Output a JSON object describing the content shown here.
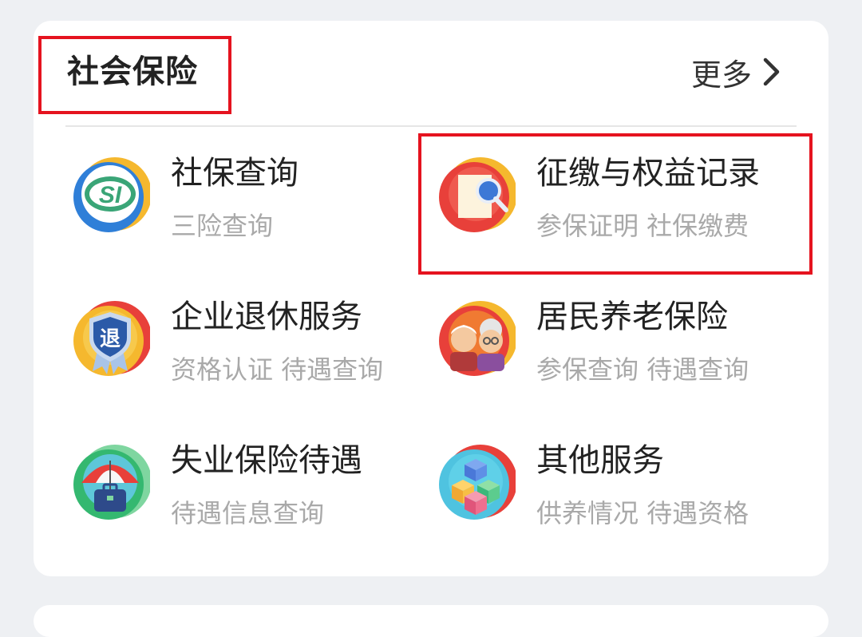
{
  "section": {
    "title": "社会保险",
    "more_label": "更多"
  },
  "items": [
    {
      "title": "社保查询",
      "subtitle": "三险查询",
      "icon": "si-logo-icon"
    },
    {
      "title": "征缴与权益记录",
      "subtitle": "参保证明 社保缴费",
      "icon": "document-search-icon"
    },
    {
      "title": "企业退休服务",
      "subtitle": "资格认证 待遇查询",
      "icon": "retirement-badge-icon"
    },
    {
      "title": "居民养老保险",
      "subtitle": "参保查询 待遇查询",
      "icon": "elderly-couple-icon"
    },
    {
      "title": "失业保险待遇",
      "subtitle": "待遇信息查询",
      "icon": "umbrella-briefcase-icon"
    },
    {
      "title": "其他服务",
      "subtitle": "供养情况 待遇资格",
      "icon": "cubes-icon"
    }
  ],
  "highlight_color": "#e5131f"
}
